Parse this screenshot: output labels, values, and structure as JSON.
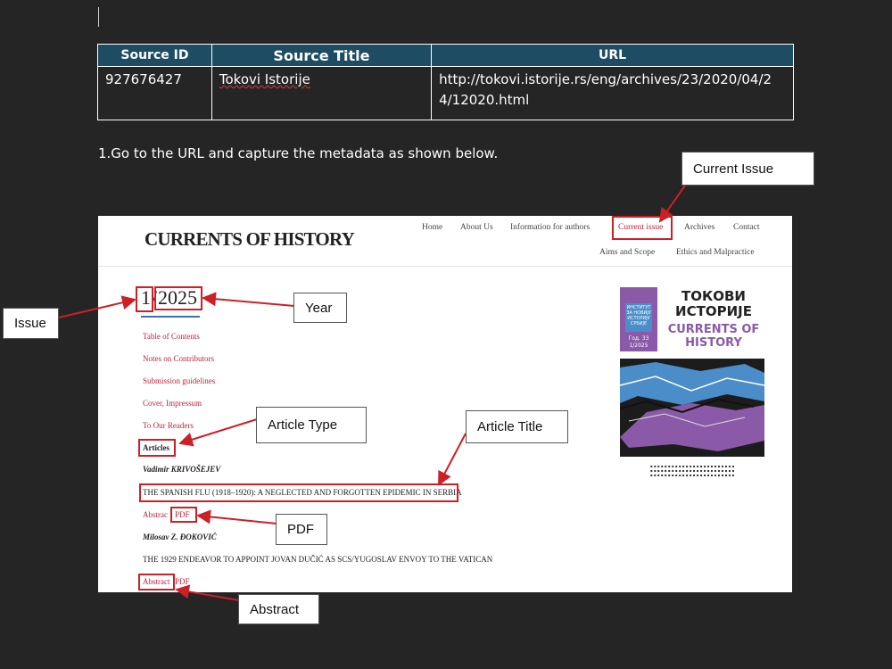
{
  "table": {
    "headers": [
      "Source ID",
      "Source Title",
      "URL"
    ],
    "row": {
      "source_id": "927676427",
      "source_title": "Tokovi Istorije",
      "url_line1": "http://tokovi.istorije.rs/eng/archives/23/2020/04/2",
      "url_line2": "4/12020.html"
    }
  },
  "instruction": "1.Go to the URL and capture the metadata as shown below.",
  "callouts": {
    "current_issue": "Current Issue",
    "issue": "Issue",
    "year": "Year",
    "article_type": "Article Type",
    "article_title": "Article Title",
    "pdf": "PDF",
    "abstract": "Abstract"
  },
  "site": {
    "logo": "CURRENTS OF HISTORY",
    "nav": {
      "home": "Home",
      "about": "About Us",
      "authors": "Information for authors",
      "current": "Current issue",
      "archives": "Archives",
      "contact": "Contact",
      "aims": "Aims and Scope",
      "ethics": "Ethics and Malpractice"
    },
    "issue_number": "1",
    "issue_separator": "/",
    "issue_year": "2025",
    "links": {
      "toc": "Table of Contents",
      "contributors": "Notes on Contributors",
      "submission": "Submission guidelines",
      "cover": "Cover, Impressum",
      "readers": "To Our Readers"
    },
    "section": "Articles",
    "articles": [
      {
        "author": "Vadimir KRIVOŠEJEV",
        "title": "THE SPANISH FLU (1918–1920): A NEGLECTED AND FORGOTTEN EPIDEMIC IN SERBIA",
        "abstract": "Abstrac",
        "pdf": "PDF"
      },
      {
        "author": "Milosav Z. ĐOKOVIĆ",
        "title": "THE 1929 ENDEAVOR TO APPOINT JOVAN DUČIĆ AS SCS/YUGOSLAV ENVOY TO THE VATICAN",
        "abstract": "Abstract",
        "pdf": "PDF"
      }
    ],
    "cover": {
      "cyrillic_title": "ТОКОВИ ИСТОРИЈЕ",
      "english_title": "CURRENTS OF HISTORY",
      "institute": "ИНСТИТУТ ЗА НОВИЈУ ИСТОРИЈУ СРБИЈЕ",
      "volume": "Год. 33",
      "issue": "1/2025"
    }
  },
  "colors": {
    "header_fill": "#1e4c62",
    "annotation_red": "#cc1f26",
    "link_red": "#c0233d",
    "page_bg": "#252525"
  }
}
